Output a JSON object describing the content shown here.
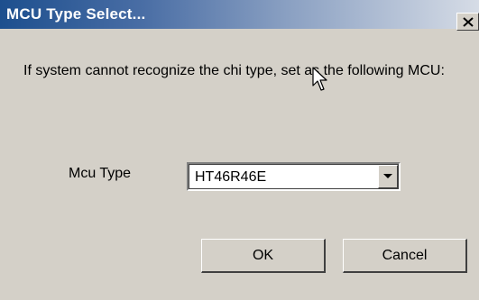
{
  "dialog": {
    "title": "MCU Type Select...",
    "close_label": "×",
    "message": "If system cannot recognize the chi type, set as the following MCU:"
  },
  "mcu": {
    "label": "Mcu Type",
    "selected": "HT46R46E"
  },
  "buttons": {
    "ok": "OK",
    "cancel": "Cancel"
  },
  "colors": {
    "title_start": "#1d4f8e",
    "title_end": "#d6dce6",
    "face": "#d4d0c8"
  }
}
